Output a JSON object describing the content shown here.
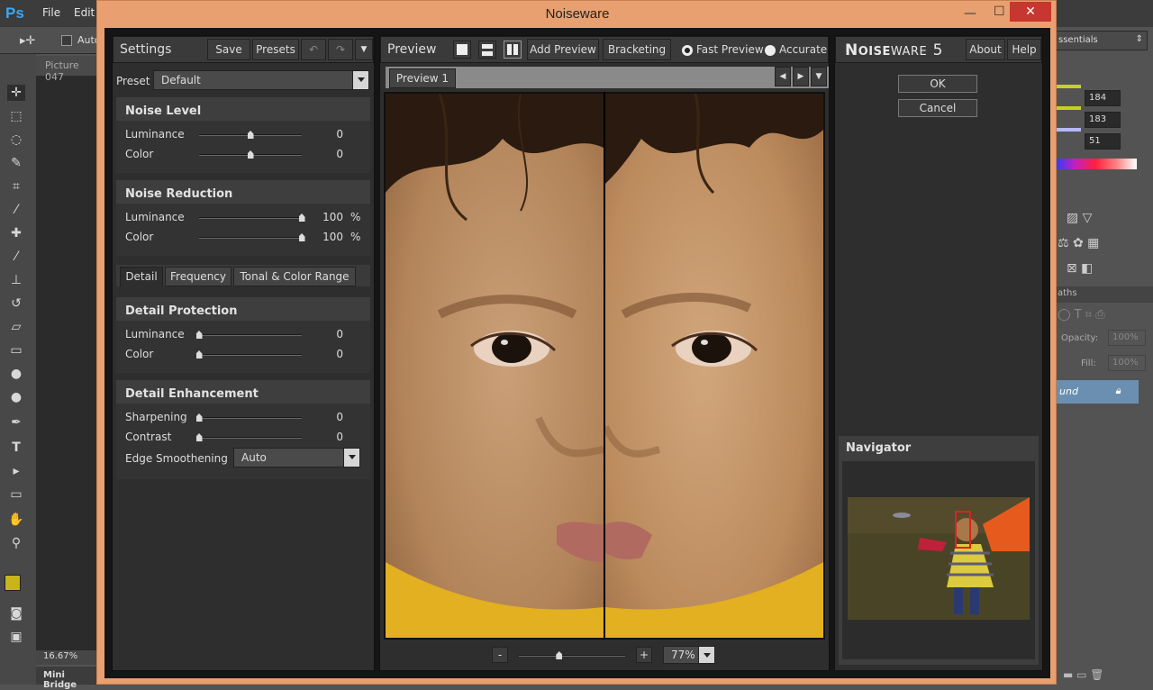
{
  "photoshop": {
    "logo": "Ps",
    "menu": [
      "File",
      "Edit"
    ],
    "option_auto": "Auto",
    "doc_tab": "Picture 047",
    "zoom_status": "16.67%",
    "mini_bridge": "Mini Bridge",
    "workspace": "ssentials",
    "color_values": [
      "184",
      "183",
      "51"
    ],
    "layers_opacity_label": "Opacity:",
    "layers_opacity": "100%",
    "layers_fill_label": "Fill:",
    "layers_fill": "100%",
    "layer_name": "und",
    "paths_tab": "aths"
  },
  "window": {
    "title": "Noiseware"
  },
  "settings": {
    "title": "Settings",
    "save_label": "Save",
    "presets_label": "Presets",
    "preset_label": "Preset",
    "preset_value": "Default",
    "noise_level": {
      "title": "Noise Level",
      "luminance_label": "Luminance",
      "luminance_value": "0",
      "luminance_fraction": 0.5,
      "color_label": "Color",
      "color_value": "0",
      "color_fraction": 0.5
    },
    "noise_reduction": {
      "title": "Noise Reduction",
      "luminance_label": "Luminance",
      "luminance_value": "100",
      "luminance_fraction": 1.0,
      "color_label": "Color",
      "color_value": "100",
      "color_fraction": 1.0,
      "unit": "%"
    },
    "tabs": [
      "Detail",
      "Frequency",
      "Tonal & Color Range"
    ],
    "detail_protection": {
      "title": "Detail Protection",
      "luminance_label": "Luminance",
      "luminance_value": "0",
      "luminance_fraction": 0,
      "color_label": "Color",
      "color_value": "0",
      "color_fraction": 0
    },
    "detail_enhancement": {
      "title": "Detail Enhancement",
      "sharpening_label": "Sharpening",
      "sharpening_value": "0",
      "sharpening_fraction": 0,
      "contrast_label": "Contrast",
      "contrast_value": "0",
      "contrast_fraction": 0,
      "edge_label": "Edge Smoothening",
      "edge_value": "Auto"
    }
  },
  "preview": {
    "title": "Preview",
    "add_preview_label": "Add Preview",
    "bracketing_label": "Bracketing",
    "fast_preview_label": "Fast Preview",
    "accurate_label": "Accurate",
    "fast_selected": true,
    "tab_label": "Preview 1",
    "zoom_minus": "-",
    "zoom_plus": "+",
    "zoom_value": "77%",
    "zoom_fraction": 0.38
  },
  "right": {
    "brand_prefix": "N",
    "brand_mid": "OISE",
    "brand_ware": "WARE",
    "brand_version": "5",
    "about_label": "About",
    "help_label": "Help",
    "ok_label": "OK",
    "cancel_label": "Cancel",
    "navigator_title": "Navigator"
  },
  "colors": {
    "window_frame": "#e8a070",
    "close_button": "#c7372f",
    "ps_logo": "#3fa6f0",
    "foreground_swatch": "#c8b51a",
    "navigator_box": "#e02020"
  }
}
